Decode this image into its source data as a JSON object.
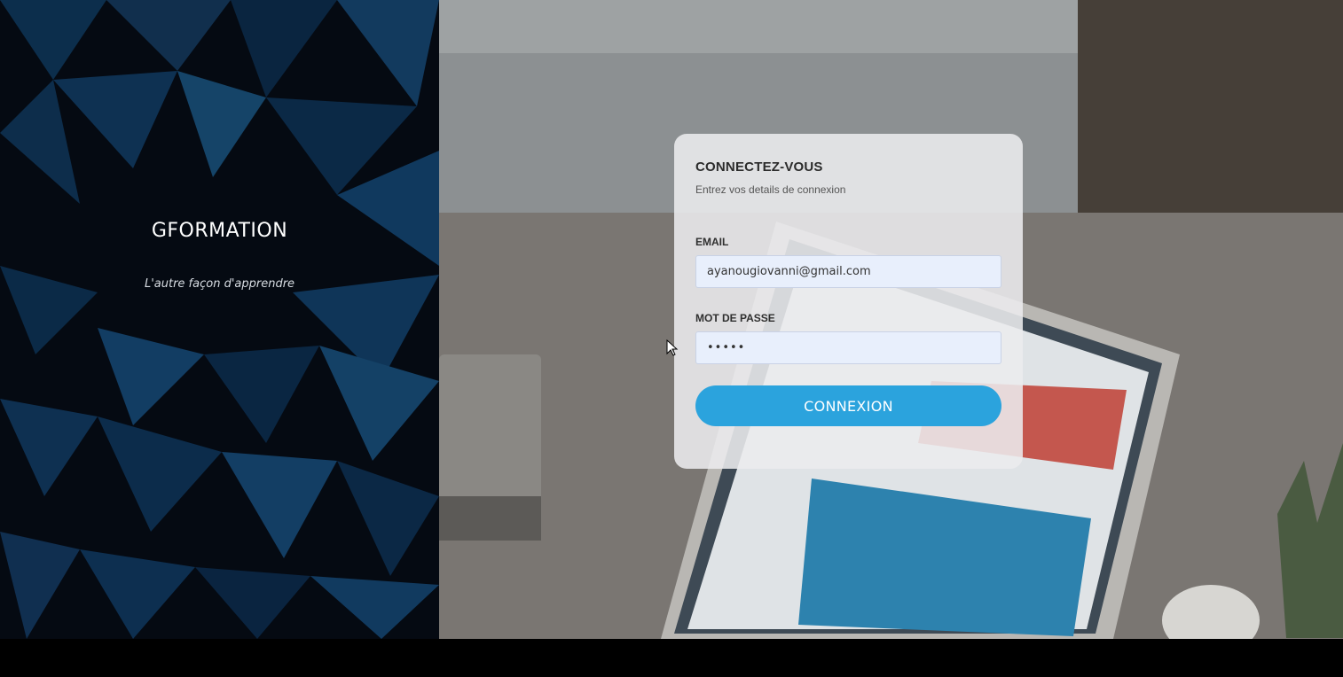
{
  "brand": {
    "name": "GFORMATION",
    "tagline": "L'autre façon d'apprendre"
  },
  "login": {
    "title": "CONNECTEZ-VOUS",
    "subtitle": "Entrez vos details de connexion",
    "email": {
      "label": "EMAIL",
      "value": "ayanougiovanni@gmail.com"
    },
    "password": {
      "label": "MOT DE PASSE",
      "value": "•••••"
    },
    "submit_label": "CONNEXION"
  },
  "colors": {
    "accent": "#2ba3dd",
    "left_panel": "#050a12",
    "triangles": "#0f3556"
  },
  "icons": {
    "cursor": "mouse-pointer-icon"
  }
}
